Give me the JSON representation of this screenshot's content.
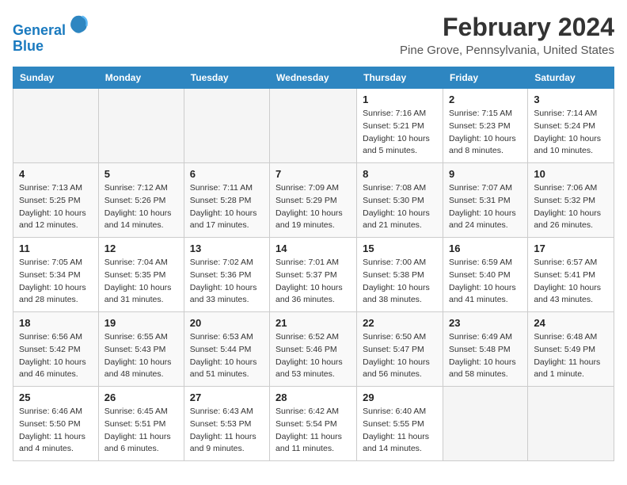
{
  "logo": {
    "line1": "General",
    "line2": "Blue"
  },
  "title": "February 2024",
  "location": "Pine Grove, Pennsylvania, United States",
  "days_of_week": [
    "Sunday",
    "Monday",
    "Tuesday",
    "Wednesday",
    "Thursday",
    "Friday",
    "Saturday"
  ],
  "weeks": [
    [
      {
        "day": "",
        "detail": ""
      },
      {
        "day": "",
        "detail": ""
      },
      {
        "day": "",
        "detail": ""
      },
      {
        "day": "",
        "detail": ""
      },
      {
        "day": "1",
        "detail": "Sunrise: 7:16 AM\nSunset: 5:21 PM\nDaylight: 10 hours\nand 5 minutes."
      },
      {
        "day": "2",
        "detail": "Sunrise: 7:15 AM\nSunset: 5:23 PM\nDaylight: 10 hours\nand 8 minutes."
      },
      {
        "day": "3",
        "detail": "Sunrise: 7:14 AM\nSunset: 5:24 PM\nDaylight: 10 hours\nand 10 minutes."
      }
    ],
    [
      {
        "day": "4",
        "detail": "Sunrise: 7:13 AM\nSunset: 5:25 PM\nDaylight: 10 hours\nand 12 minutes."
      },
      {
        "day": "5",
        "detail": "Sunrise: 7:12 AM\nSunset: 5:26 PM\nDaylight: 10 hours\nand 14 minutes."
      },
      {
        "day": "6",
        "detail": "Sunrise: 7:11 AM\nSunset: 5:28 PM\nDaylight: 10 hours\nand 17 minutes."
      },
      {
        "day": "7",
        "detail": "Sunrise: 7:09 AM\nSunset: 5:29 PM\nDaylight: 10 hours\nand 19 minutes."
      },
      {
        "day": "8",
        "detail": "Sunrise: 7:08 AM\nSunset: 5:30 PM\nDaylight: 10 hours\nand 21 minutes."
      },
      {
        "day": "9",
        "detail": "Sunrise: 7:07 AM\nSunset: 5:31 PM\nDaylight: 10 hours\nand 24 minutes."
      },
      {
        "day": "10",
        "detail": "Sunrise: 7:06 AM\nSunset: 5:32 PM\nDaylight: 10 hours\nand 26 minutes."
      }
    ],
    [
      {
        "day": "11",
        "detail": "Sunrise: 7:05 AM\nSunset: 5:34 PM\nDaylight: 10 hours\nand 28 minutes."
      },
      {
        "day": "12",
        "detail": "Sunrise: 7:04 AM\nSunset: 5:35 PM\nDaylight: 10 hours\nand 31 minutes."
      },
      {
        "day": "13",
        "detail": "Sunrise: 7:02 AM\nSunset: 5:36 PM\nDaylight: 10 hours\nand 33 minutes."
      },
      {
        "day": "14",
        "detail": "Sunrise: 7:01 AM\nSunset: 5:37 PM\nDaylight: 10 hours\nand 36 minutes."
      },
      {
        "day": "15",
        "detail": "Sunrise: 7:00 AM\nSunset: 5:38 PM\nDaylight: 10 hours\nand 38 minutes."
      },
      {
        "day": "16",
        "detail": "Sunrise: 6:59 AM\nSunset: 5:40 PM\nDaylight: 10 hours\nand 41 minutes."
      },
      {
        "day": "17",
        "detail": "Sunrise: 6:57 AM\nSunset: 5:41 PM\nDaylight: 10 hours\nand 43 minutes."
      }
    ],
    [
      {
        "day": "18",
        "detail": "Sunrise: 6:56 AM\nSunset: 5:42 PM\nDaylight: 10 hours\nand 46 minutes."
      },
      {
        "day": "19",
        "detail": "Sunrise: 6:55 AM\nSunset: 5:43 PM\nDaylight: 10 hours\nand 48 minutes."
      },
      {
        "day": "20",
        "detail": "Sunrise: 6:53 AM\nSunset: 5:44 PM\nDaylight: 10 hours\nand 51 minutes."
      },
      {
        "day": "21",
        "detail": "Sunrise: 6:52 AM\nSunset: 5:46 PM\nDaylight: 10 hours\nand 53 minutes."
      },
      {
        "day": "22",
        "detail": "Sunrise: 6:50 AM\nSunset: 5:47 PM\nDaylight: 10 hours\nand 56 minutes."
      },
      {
        "day": "23",
        "detail": "Sunrise: 6:49 AM\nSunset: 5:48 PM\nDaylight: 10 hours\nand 58 minutes."
      },
      {
        "day": "24",
        "detail": "Sunrise: 6:48 AM\nSunset: 5:49 PM\nDaylight: 11 hours\nand 1 minute."
      }
    ],
    [
      {
        "day": "25",
        "detail": "Sunrise: 6:46 AM\nSunset: 5:50 PM\nDaylight: 11 hours\nand 4 minutes."
      },
      {
        "day": "26",
        "detail": "Sunrise: 6:45 AM\nSunset: 5:51 PM\nDaylight: 11 hours\nand 6 minutes."
      },
      {
        "day": "27",
        "detail": "Sunrise: 6:43 AM\nSunset: 5:53 PM\nDaylight: 11 hours\nand 9 minutes."
      },
      {
        "day": "28",
        "detail": "Sunrise: 6:42 AM\nSunset: 5:54 PM\nDaylight: 11 hours\nand 11 minutes."
      },
      {
        "day": "29",
        "detail": "Sunrise: 6:40 AM\nSunset: 5:55 PM\nDaylight: 11 hours\nand 14 minutes."
      },
      {
        "day": "",
        "detail": ""
      },
      {
        "day": "",
        "detail": ""
      }
    ]
  ]
}
